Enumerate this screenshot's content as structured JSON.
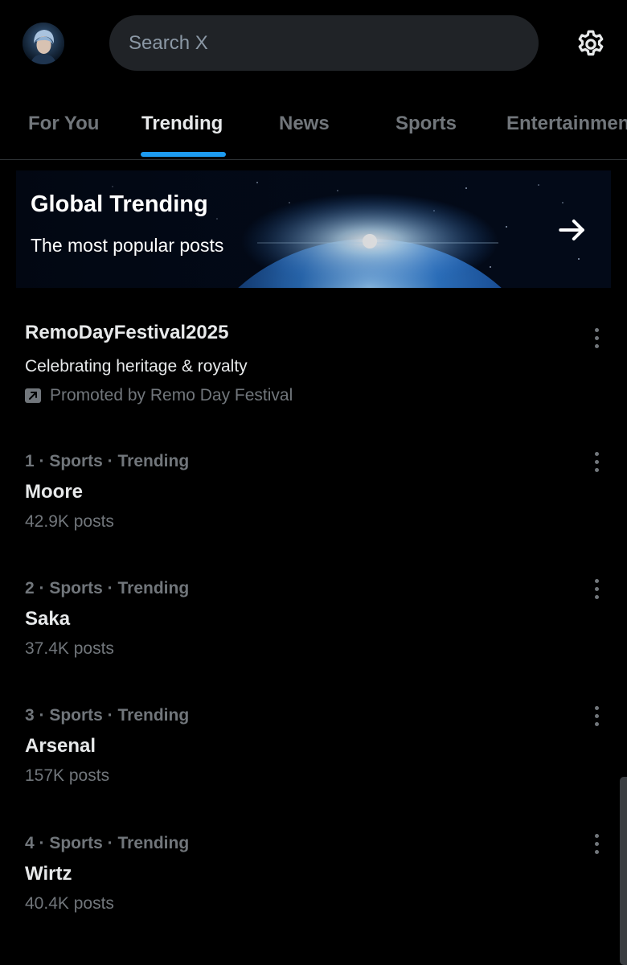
{
  "header": {
    "avatar_icon": "profile-avatar",
    "search_placeholder": "Search X",
    "settings_icon": "gear-icon"
  },
  "tabs": [
    {
      "label": "For You",
      "active": false
    },
    {
      "label": "Trending",
      "active": true
    },
    {
      "label": "News",
      "active": false
    },
    {
      "label": "Sports",
      "active": false
    },
    {
      "label": "Entertainment",
      "active": false
    }
  ],
  "banner": {
    "title": "Global Trending",
    "subtitle": "The most popular posts",
    "arrow_icon": "arrow-right-icon"
  },
  "promoted": {
    "title": "RemoDayFestival2025",
    "description": "Celebrating heritage & royalty",
    "promoted_by": "Promoted by Remo Day Festival",
    "icon": "promoted-icon"
  },
  "trends": [
    {
      "meta": "1 · Sports · Trending",
      "name": "Moore",
      "count": "42.9K posts"
    },
    {
      "meta": "2 · Sports · Trending",
      "name": "Saka",
      "count": "37.4K posts"
    },
    {
      "meta": "3 · Sports · Trending",
      "name": "Arsenal",
      "count": "157K posts"
    },
    {
      "meta": "4 · Sports · Trending",
      "name": "Wirtz",
      "count": "40.4K posts"
    }
  ],
  "colors": {
    "background": "#000000",
    "accent": "#1d9bf0",
    "text_primary": "#e7e9ea",
    "text_secondary": "#71767b",
    "search_bg": "#202327"
  }
}
